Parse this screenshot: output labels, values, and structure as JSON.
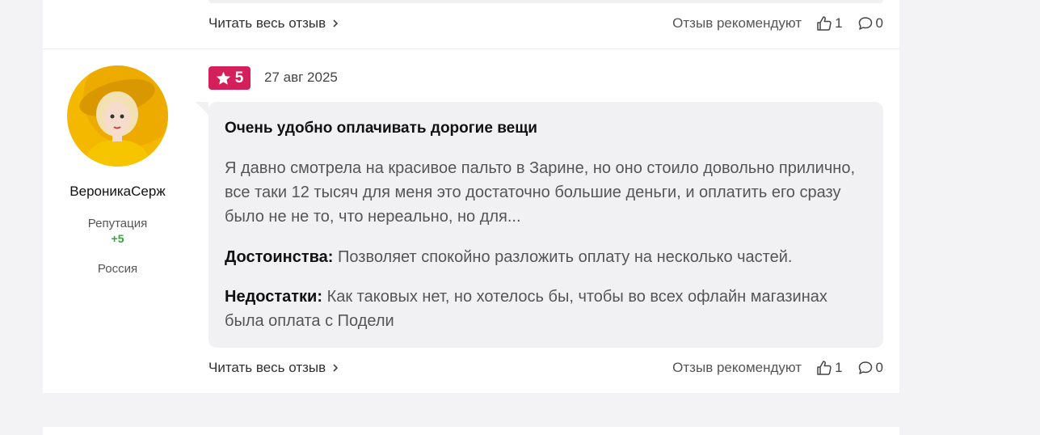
{
  "previous_review": {
    "read_more": "Читать весь отзыв",
    "recommend_label": "Отзыв рекомендуют",
    "likes": "1",
    "comments": "0"
  },
  "review": {
    "author": {
      "name": "ВероникаСерж",
      "reputation_label": "Репутация",
      "reputation_value": "+5",
      "country": "Россия"
    },
    "rating": "5",
    "date": "27 авг 2025",
    "title": "Очень удобно оплачивать дорогие вещи",
    "text": "Я давно смотрела на красивое пальто в Зарине, но оно стоило довольно прилично, все таки 12 тысяч для меня это достаточно большие деньги, и оплатить его сразу было не не то, что нереально, но для...",
    "pros_label": "Достоинства:",
    "pros_text": "Позволяет спокойно разложить оплату на несколько частей.",
    "cons_label": "Недостатки:",
    "cons_text": "Как таковых нет, но хотелось бы, чтобы во всех офлайн магазинах была оплата с Подели",
    "read_more": "Читать весь отзыв",
    "recommend_label": "Отзыв рекомендуют",
    "likes": "1",
    "comments": "0"
  },
  "colors": {
    "rating_badge": "#d4205a",
    "reputation_positive": "#2ea83a",
    "bubble_bg": "#f1f1f3",
    "page_bg": "#f3f3f5",
    "avatar_bg": "#f5b800"
  },
  "icons": [
    "chevron-right-icon",
    "thumbs-up-icon",
    "comment-icon",
    "star-icon"
  ]
}
